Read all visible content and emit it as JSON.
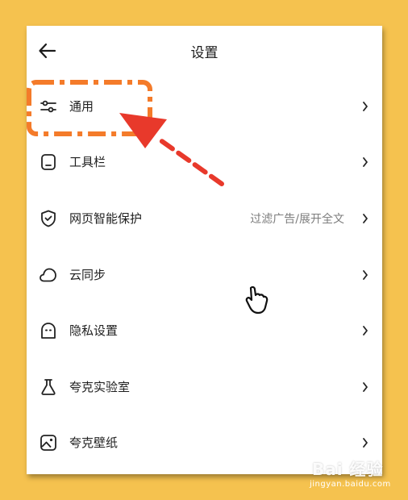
{
  "header": {
    "title": "设置",
    "back_icon": "arrow-left-icon"
  },
  "settings": [
    {
      "key": "general",
      "label": "通用",
      "icon": "sliders-icon",
      "hint": ""
    },
    {
      "key": "toolbar",
      "label": "工具栏",
      "icon": "toolbar-icon",
      "hint": ""
    },
    {
      "key": "web-protection",
      "label": "网页智能保护",
      "icon": "shield-check-icon",
      "hint": "过滤广告/展开全文"
    },
    {
      "key": "cloud-sync",
      "label": "云同步",
      "icon": "cloud-icon",
      "hint": ""
    },
    {
      "key": "privacy",
      "label": "隐私设置",
      "icon": "privacy-ghost-icon",
      "hint": ""
    },
    {
      "key": "lab",
      "label": "夸克实验室",
      "icon": "flask-icon",
      "hint": ""
    },
    {
      "key": "wallpaper",
      "label": "夸克壁纸",
      "icon": "image-icon",
      "hint": ""
    }
  ],
  "annotation": {
    "highlight_color": "#F47B2A",
    "arrow_color": "#E8392B"
  },
  "watermark": {
    "brand": "Bai 经验",
    "url": "jingyan.baidu.com"
  },
  "colors": {
    "background": "#F5C24F",
    "panel": "#FFFFFF",
    "text": "#1F1F1F",
    "hint": "#7D7D7D"
  }
}
